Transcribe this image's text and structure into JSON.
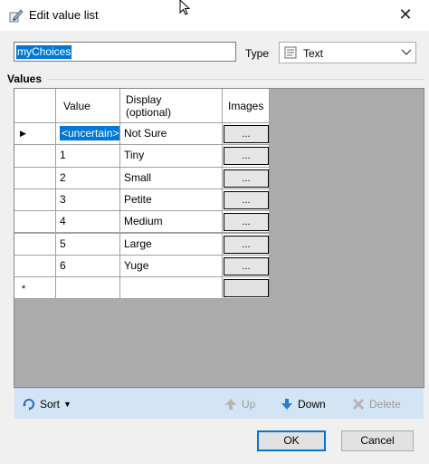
{
  "window": {
    "title": "Edit value list",
    "close_glyph": "✕"
  },
  "name_field": {
    "value": "myChoices"
  },
  "type": {
    "label": "Type",
    "selected": "Text",
    "icon": "text-type-icon"
  },
  "values_section": {
    "label": "Values"
  },
  "grid": {
    "headers": {
      "value": "Value",
      "display": "Display\n(optional)",
      "images": "Images"
    },
    "rows": [
      {
        "value": "<uncertain>",
        "display": "Not Sure",
        "images": "..."
      },
      {
        "value": "1",
        "display": "Tiny",
        "images": "..."
      },
      {
        "value": "2",
        "display": "Small",
        "images": "..."
      },
      {
        "value": "3",
        "display": "Petite",
        "images": "..."
      },
      {
        "value": "4",
        "display": "Medium",
        "images": "..."
      },
      {
        "value": "5",
        "display": "Large",
        "images": "..."
      },
      {
        "value": "6",
        "display": "Yuge",
        "images": "..."
      }
    ],
    "new_row_marker": "*",
    "current_row_marker": "▶"
  },
  "toolbar": {
    "sort": "Sort",
    "up": "Up",
    "down": "Down",
    "delete": "Delete"
  },
  "buttons": {
    "ok": "OK",
    "cancel": "Cancel"
  },
  "colors": {
    "accent": "#0078d7",
    "toolbar_bg": "#d3e5f5"
  }
}
